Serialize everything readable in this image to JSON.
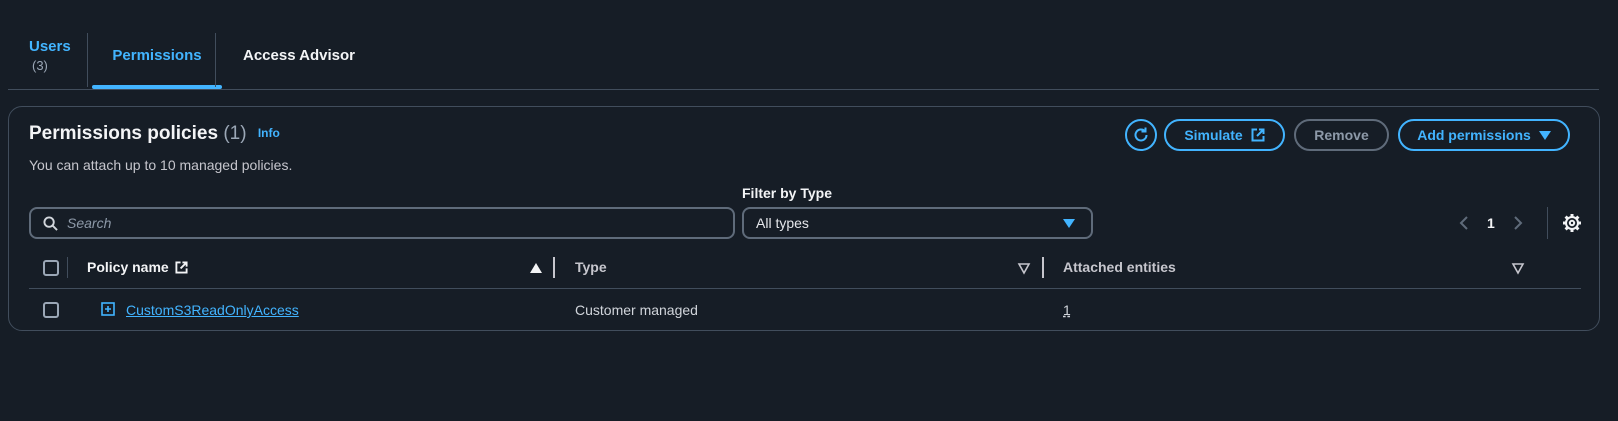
{
  "tabs": {
    "users_label": "Users",
    "users_count": "(3)",
    "permissions_label": "Permissions",
    "advisor_label": "Access Advisor"
  },
  "panel": {
    "title": "Permissions policies",
    "count": "(1)",
    "info": "Info",
    "description": "You can attach up to 10 managed policies."
  },
  "actions": {
    "refresh_icon": "refresh-icon",
    "simulate_label": "Simulate",
    "remove_label": "Remove",
    "add_label": "Add permissions"
  },
  "filters": {
    "search_placeholder": "Search",
    "type_label": "Filter by Type",
    "type_value": "All types"
  },
  "pagination": {
    "current_page": "1"
  },
  "table": {
    "headers": {
      "policy_name": "Policy name",
      "type": "Type",
      "attached_entities": "Attached entities"
    },
    "rows": [
      {
        "policy_name": "CustomS3ReadOnlyAccess",
        "type": "Customer managed",
        "attached_entities": "1"
      }
    ]
  },
  "colors": {
    "accent": "#42b4ff",
    "background": "#161d26",
    "border": "#414d5c"
  }
}
